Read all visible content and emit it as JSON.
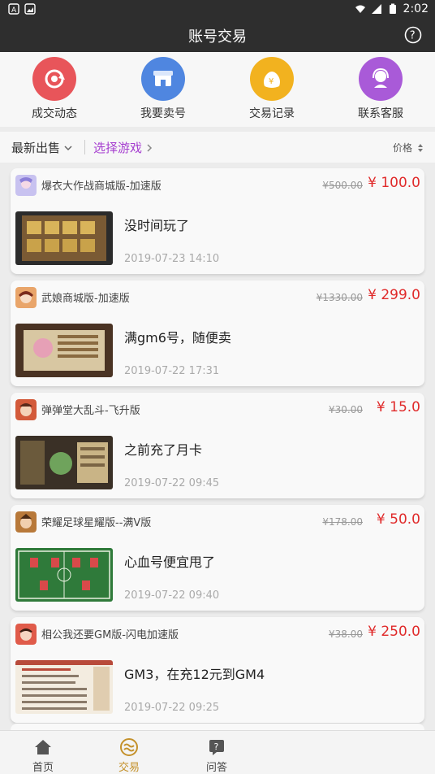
{
  "status": {
    "time": "2:02"
  },
  "header": {
    "title": "账号交易"
  },
  "quick_actions": [
    {
      "label": "成交动态",
      "color": "#e8555a",
      "icon": "refresh-icon"
    },
    {
      "label": "我要卖号",
      "color": "#4f86e0",
      "icon": "shop-icon"
    },
    {
      "label": "交易记录",
      "color": "#f2b21f",
      "icon": "money-bag-icon"
    },
    {
      "label": "联系客服",
      "color": "#a95ad8",
      "icon": "headset-icon"
    }
  ],
  "filter": {
    "sort_label": "最新出售",
    "pick_label": "选择游戏",
    "price_label": "价格",
    "accent": "#a63fd0"
  },
  "listings": [
    {
      "game": "爆衣大作战商城版-加速版",
      "old_price": "¥500.00",
      "price": "¥ 100.0",
      "desc": "没时间玩了",
      "time": "2019-07-23 14:10"
    },
    {
      "game": "武娘商城版-加速版",
      "old_price": "¥1330.00",
      "price": "¥ 299.0",
      "desc": "满gm6号，随便卖",
      "time": "2019-07-22 17:31"
    },
    {
      "game": "弹弹堂大乱斗-飞升版",
      "old_price": "¥30.00",
      "price": "¥ 15.0",
      "desc": "之前充了月卡",
      "time": "2019-07-22 09:45"
    },
    {
      "game": "荣耀足球星耀版--满V版",
      "old_price": "¥178.00",
      "price": "¥ 50.0",
      "desc": "心血号便宜甩了",
      "time": "2019-07-22 09:40"
    },
    {
      "game": "相公我还要GM版-闪电加速版",
      "old_price": "¥38.00",
      "price": "¥ 250.0",
      "desc": "GM3，在充12元到GM4",
      "time": "2019-07-22 09:25"
    }
  ],
  "bottom_nav": [
    {
      "label": "首页",
      "icon": "home-icon"
    },
    {
      "label": "交易",
      "icon": "trade-icon",
      "active": true
    },
    {
      "label": "问答",
      "icon": "question-icon"
    }
  ],
  "price_color": "#e02a2a"
}
